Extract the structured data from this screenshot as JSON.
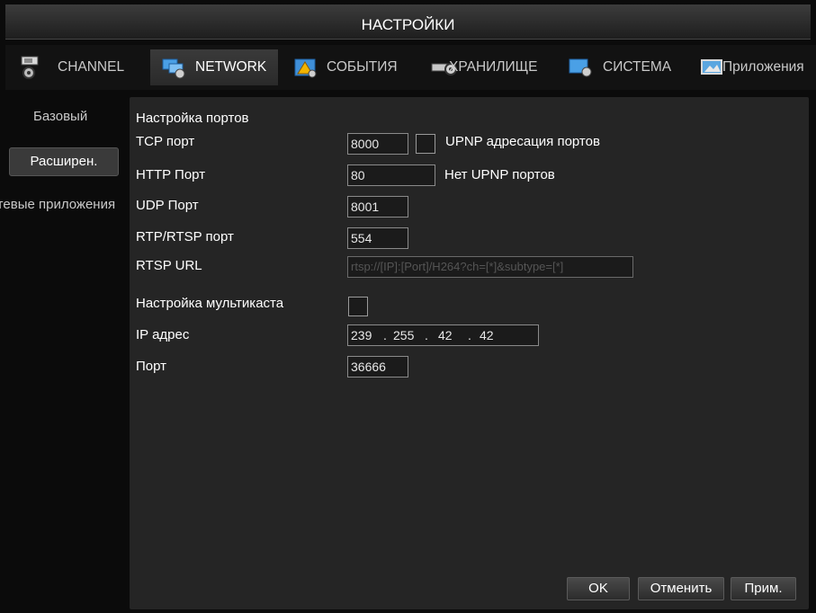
{
  "window": {
    "title": "НАСТРОЙКИ"
  },
  "tabs": [
    {
      "label": "CHANNEL",
      "icon": "camera-icon"
    },
    {
      "label": "NETWORK",
      "icon": "network-icon",
      "active": true
    },
    {
      "label": "СОБЫТИЯ",
      "icon": "alarm-icon"
    },
    {
      "label": "ХРАНИЛИЩЕ",
      "icon": "storage-icon"
    },
    {
      "label": "СИСТЕМА",
      "icon": "system-icon"
    },
    {
      "label": "Приложения",
      "icon": "apps-icon"
    }
  ],
  "sidebar": {
    "items": [
      {
        "label": "Базовый"
      },
      {
        "label": "Расширен.",
        "active": true
      },
      {
        "label": "Сетевые приложения"
      }
    ]
  },
  "form": {
    "section_title": "Настройка портов",
    "tcp": {
      "label": "TCP порт",
      "value": "8000"
    },
    "upnp": {
      "label": "UPNP адресация портов",
      "checked": false
    },
    "http": {
      "label": "HTTP Порт",
      "value": "80"
    },
    "no_upnp": {
      "label": "Нет UPNP портов"
    },
    "udp": {
      "label": "UDP Порт",
      "value": "8001"
    },
    "rtsp": {
      "label": "RTP/RTSP порт",
      "value": "554"
    },
    "rtsp_url": {
      "label": "RTSP URL",
      "value": "rtsp://[IP]:[Port]/H264?ch=[*]&subtype=[*]"
    },
    "multicast": {
      "label": "Настройка мультикаста",
      "checked": false
    },
    "ip": {
      "label": "IP адрес",
      "octets": [
        "239",
        "255",
        "42",
        "42"
      ],
      "sep": "."
    },
    "port": {
      "label": "Порт",
      "value": "36666"
    }
  },
  "buttons": {
    "ok": "OK",
    "cancel": "Отменить",
    "apply": "Прим."
  },
  "colors": {
    "background": "#0b0b0b",
    "panel": "#252525",
    "text": "#ffffff"
  }
}
